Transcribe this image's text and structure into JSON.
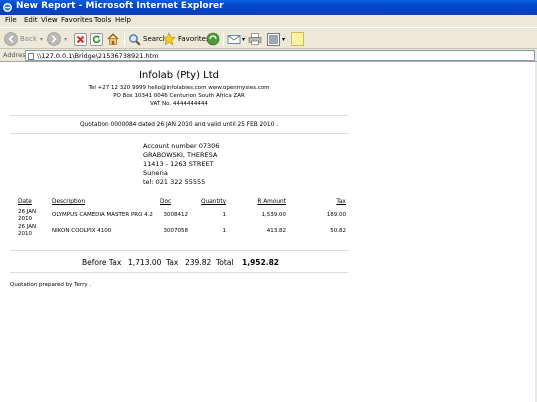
{
  "window": {
    "title": "New Report - Microsoft Internet Explorer"
  },
  "menu": [
    "File",
    "Edit",
    "View",
    "Favorites",
    "Tools",
    "Help"
  ],
  "toolbar": {
    "back": "Back",
    "search": "Search",
    "favorites": "Favorites"
  },
  "address": {
    "label": "Address",
    "url": "\\\\127.0.0.1\\Bridge\\21536738921.htm"
  },
  "report": {
    "company": "Infolab (Pty) Ltd",
    "contact_line": "Tel +27 12 320 9999 hello@infolabies.com www.openmysies.com",
    "po_box": "PO Box 10341 0046 Centurion South Africa ZAR",
    "vat": "VAT No. 4444444444",
    "quotation_line": "Quotation 0000084 dated 26 JAN 2010 and valid until 25 FEB 2010 .",
    "account": {
      "number": "Account number 07306",
      "name": "GRABOWSKI, THERESA",
      "street": "11413 - 1263 STREET",
      "city": "Suneria",
      "tel": "tel: 021 322 55555"
    },
    "columns": [
      "Date",
      "Description",
      "Doc",
      "Quantity",
      "R Amount",
      "Tax"
    ],
    "rows": [
      {
        "date1": "26 JAN",
        "date2": "2010",
        "description": "OLYMPUS CAMEDIA MASTER PRO 4.2",
        "doc": "3008412",
        "qty": "1",
        "amount": "1,539.00",
        "tax": "189.00"
      },
      {
        "date1": "26 JAN",
        "date2": "2010",
        "description": "NIKON COOLPIX 4100",
        "doc": "3007058",
        "qty": "1",
        "amount": "413.82",
        "tax": "50.82"
      }
    ],
    "totals": {
      "before_tax_label": "Before Tax",
      "before_tax": "1,713.00",
      "tax_label": "Tax",
      "tax": "239.82",
      "total_label": "Total",
      "total": "1,952.82"
    },
    "prepared_by": "Quotation prepared by Terry ."
  }
}
